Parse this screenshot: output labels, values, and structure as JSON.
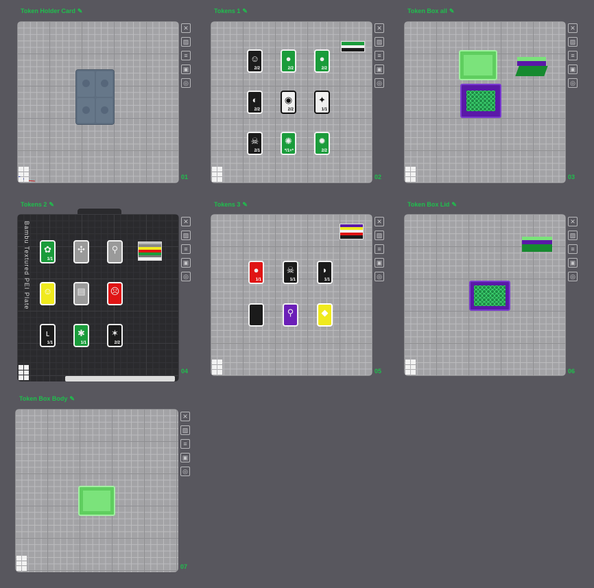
{
  "plates": [
    {
      "title": "Token Holder Card",
      "number": "01"
    },
    {
      "title": "Tokens 1",
      "number": "02"
    },
    {
      "title": "Token Box all",
      "number": "03"
    },
    {
      "title": "Tokens 2",
      "number": "04",
      "plate_label": "Bambu Textured PEI Plate"
    },
    {
      "title": "Tokens 3",
      "number": "05"
    },
    {
      "title": "Token Box Lid",
      "number": "06"
    },
    {
      "title": "Token Box Body",
      "number": "07"
    }
  ],
  "tool_icons": [
    "close-icon",
    "image-icon",
    "layers-icon",
    "lock-icon",
    "settings-icon"
  ],
  "tokens1": [
    {
      "color": "black",
      "symbol": "☺",
      "value": "2/2"
    },
    {
      "color": "green",
      "symbol": "●",
      "value": "2/2"
    },
    {
      "color": "green",
      "symbol": "●",
      "value": "2/2"
    },
    {
      "color": "black",
      "symbol": "◐",
      "value": "2/2"
    },
    {
      "color": "white",
      "symbol": "◉",
      "value": "2/2"
    },
    {
      "color": "white",
      "symbol": "✦",
      "value": "1/1"
    },
    {
      "color": "black",
      "symbol": "☠",
      "value": "2/1"
    },
    {
      "color": "green",
      "symbol": "✺",
      "value": "*/1+*"
    },
    {
      "color": "green",
      "symbol": "✹",
      "value": "2/2"
    }
  ],
  "tokens2": [
    {
      "color": "green",
      "symbol": "✿",
      "value": "1/1"
    },
    {
      "color": "grey",
      "symbol": "✣",
      "value": ""
    },
    {
      "color": "grey",
      "symbol": "⚲",
      "value": ""
    },
    {
      "color": "yellow",
      "symbol": "☺",
      "value": ""
    },
    {
      "color": "grey",
      "symbol": "▤",
      "value": ""
    },
    {
      "color": "red",
      "symbol": "☹",
      "value": ""
    },
    {
      "color": "black",
      "symbol": "ʟ",
      "value": "1/1"
    },
    {
      "color": "green",
      "symbol": "✱",
      "value": "1/1"
    },
    {
      "color": "black",
      "symbol": "✶",
      "value": "2/2"
    }
  ],
  "tokens3": [
    {
      "color": "red",
      "symbol": "●",
      "value": "1/1"
    },
    {
      "color": "black",
      "symbol": "☠",
      "value": "1/1"
    },
    {
      "color": "black",
      "symbol": "◗",
      "value": "1/1"
    },
    {
      "color": "black",
      "symbol": "",
      "value": ""
    },
    {
      "color": "purple",
      "symbol": "⚲",
      "value": ""
    },
    {
      "color": "yellow",
      "symbol": "◆",
      "value": ""
    }
  ],
  "colors": {
    "accent": "#1fbf4d",
    "box_green": "#7be37b",
    "box_purple": "#5a18a8",
    "holder_blue": "#5e6e80"
  }
}
